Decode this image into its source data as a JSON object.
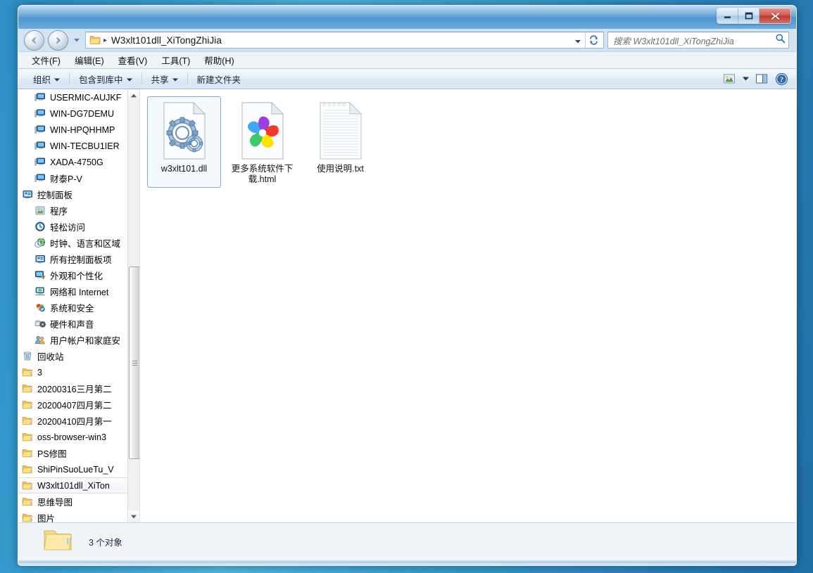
{
  "window": {
    "title": "",
    "buttons": {
      "minimize": "minimize-button",
      "maximize": "maximize-button",
      "close": "close-button"
    }
  },
  "address": {
    "back_tooltip": "后退",
    "forward_tooltip": "前进",
    "separator": "▸",
    "path": "W3xlt101dll_XiTongZhiJia",
    "dropdown": "▾",
    "refresh": "refresh-icon"
  },
  "search": {
    "placeholder": "搜索 W3xlt101dll_XiTongZhiJia",
    "value": "",
    "icon": "search-icon"
  },
  "menu": {
    "items": [
      {
        "label": "文件(F)",
        "name": "menu-file"
      },
      {
        "label": "编辑(E)",
        "name": "menu-edit"
      },
      {
        "label": "查看(V)",
        "name": "menu-view"
      },
      {
        "label": "工具(T)",
        "name": "menu-tools"
      },
      {
        "label": "帮助(H)",
        "name": "menu-help"
      }
    ]
  },
  "toolbar": {
    "organize": "组织",
    "include_library": "包含到库中",
    "share": "共享",
    "new_folder": "新建文件夹",
    "caret": "▾",
    "view_icon": "view-layout-icon",
    "view_caret": "▾",
    "preview_icon": "preview-pane-icon",
    "help_icon": "help-icon"
  },
  "sidebar": {
    "items": [
      {
        "label": "USERMIC-AUJKF",
        "icon": "computer-icon",
        "depth": 1
      },
      {
        "label": "WIN-DG7DEMU",
        "icon": "computer-icon",
        "depth": 1
      },
      {
        "label": "WIN-HPQHHMP",
        "icon": "computer-icon",
        "depth": 1
      },
      {
        "label": "WIN-TECBU1IER",
        "icon": "computer-icon",
        "depth": 1
      },
      {
        "label": "XADA-4750G",
        "icon": "computer-icon",
        "depth": 1
      },
      {
        "label": "财泰P-V",
        "icon": "computer-icon",
        "depth": 1
      },
      {
        "label": "控制面板",
        "icon": "control-panel-icon",
        "depth": 0
      },
      {
        "label": "程序",
        "icon": "programs-icon",
        "depth": 1
      },
      {
        "label": "轻松访问",
        "icon": "ease-of-access-icon",
        "depth": 1
      },
      {
        "label": "时钟、语言和区域",
        "icon": "clock-language-icon",
        "depth": 1
      },
      {
        "label": "所有控制面板项",
        "icon": "all-control-panel-icon",
        "depth": 1
      },
      {
        "label": "外观和个性化",
        "icon": "appearance-icon",
        "depth": 1
      },
      {
        "label": "网络和 Internet",
        "icon": "network-internet-icon",
        "depth": 1
      },
      {
        "label": "系统和安全",
        "icon": "system-security-icon",
        "depth": 1
      },
      {
        "label": "硬件和声音",
        "icon": "hardware-sound-icon",
        "depth": 1
      },
      {
        "label": "用户帐户和家庭安",
        "icon": "user-accounts-icon",
        "depth": 1
      },
      {
        "label": "回收站",
        "icon": "recycle-bin-icon",
        "depth": 0
      },
      {
        "label": "3",
        "icon": "folder-icon",
        "depth": 0
      },
      {
        "label": "20200316三月第二",
        "icon": "folder-icon",
        "depth": 0
      },
      {
        "label": "20200407四月第二",
        "icon": "folder-icon",
        "depth": 0
      },
      {
        "label": "20200410四月第一",
        "icon": "folder-icon",
        "depth": 0
      },
      {
        "label": "oss-browser-win3",
        "icon": "folder-icon",
        "depth": 0
      },
      {
        "label": "PS修图",
        "icon": "folder-icon",
        "depth": 0
      },
      {
        "label": "ShiPinSuoLueTu_V",
        "icon": "folder-icon",
        "depth": 0
      },
      {
        "label": "W3xlt101dll_XiTon",
        "icon": "folder-icon",
        "depth": 0,
        "selected": true
      },
      {
        "label": "思维导图",
        "icon": "folder-icon",
        "depth": 0
      },
      {
        "label": "图片",
        "icon": "folder-icon",
        "depth": 0
      }
    ],
    "scrollbar": {
      "up": "▲",
      "down": "▼"
    }
  },
  "files": [
    {
      "name": "w3xlt101.dll",
      "icon": "dll-gears-icon",
      "selected": true
    },
    {
      "name": "更多系统软件下载.html",
      "icon": "browser-pinwheel-icon",
      "selected": false
    },
    {
      "name": "使用说明.txt",
      "icon": "text-document-icon",
      "selected": false
    }
  ],
  "status": {
    "folder_icon": "folder-large-icon",
    "count_text": "3 个对象"
  },
  "colors": {
    "accent": "#4f95d2",
    "selection_border": "#7fa9d4",
    "selection_fill": "#f4f9fe",
    "close_button": "#b83b31",
    "desktop": "#3e9fcc"
  }
}
